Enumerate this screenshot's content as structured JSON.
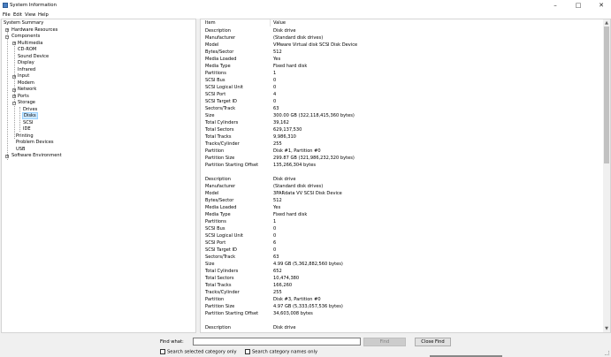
{
  "window": {
    "title": "System Information",
    "controls": [
      "minimize-icon",
      "maximize-icon",
      "close-icon"
    ]
  },
  "menu": [
    "File",
    "Edit",
    "View",
    "Help"
  ],
  "tree": {
    "system_summary": "System Summary",
    "hardware_resources": "Hardware Resources",
    "components": "Components",
    "multimedia": "Multimedia",
    "cd_rom": "CD-ROM",
    "sound_device": "Sound Device",
    "display": "Display",
    "infrared": "Infrared",
    "input": "Input",
    "modem": "Modem",
    "network": "Network",
    "ports": "Ports",
    "storage": "Storage",
    "drives": "Drives",
    "disks": "Disks",
    "scsi": "SCSI",
    "ide": "IDE",
    "printing": "Printing",
    "problem_devices": "Problem Devices",
    "usb": "USB",
    "software_environment": "Software Environment"
  },
  "details": {
    "col_item": "Item",
    "col_value": "Value",
    "disks": [
      [
        [
          "Description",
          "Disk drive"
        ],
        [
          "Manufacturer",
          "(Standard disk drives)"
        ],
        [
          "Model",
          "VMware Virtual disk SCSI Disk Device"
        ],
        [
          "Bytes/Sector",
          "512"
        ],
        [
          "Media Loaded",
          "Yes"
        ],
        [
          "Media Type",
          "Fixed hard disk"
        ],
        [
          "Partitions",
          "1"
        ],
        [
          "SCSI Bus",
          "0"
        ],
        [
          "SCSI Logical Unit",
          "0"
        ],
        [
          "SCSI Port",
          "4"
        ],
        [
          "SCSI Target ID",
          "0"
        ],
        [
          "Sectors/Track",
          "63"
        ],
        [
          "Size",
          "300.00 GB (322,118,415,360 bytes)"
        ],
        [
          "Total Cylinders",
          "39,162"
        ],
        [
          "Total Sectors",
          "629,137,530"
        ],
        [
          "Total Tracks",
          "9,986,310"
        ],
        [
          "Tracks/Cylinder",
          "255"
        ],
        [
          "Partition",
          "Disk #1, Partition #0"
        ],
        [
          "Partition Size",
          "299.87 GB (321,986,232,320 bytes)"
        ],
        [
          "Partition Starting Offset",
          "135,266,304 bytes"
        ]
      ],
      [
        [
          "Description",
          "Disk drive"
        ],
        [
          "Manufacturer",
          "(Standard disk drives)"
        ],
        [
          "Model",
          "3PARdata VV SCSI Disk Device"
        ],
        [
          "Bytes/Sector",
          "512"
        ],
        [
          "Media Loaded",
          "Yes"
        ],
        [
          "Media Type",
          "Fixed hard disk"
        ],
        [
          "Partitions",
          "1"
        ],
        [
          "SCSI Bus",
          "0"
        ],
        [
          "SCSI Logical Unit",
          "0"
        ],
        [
          "SCSI Port",
          "6"
        ],
        [
          "SCSI Target ID",
          "0"
        ],
        [
          "Sectors/Track",
          "63"
        ],
        [
          "Size",
          "4.99 GB (5,362,882,560 bytes)"
        ],
        [
          "Total Cylinders",
          "652"
        ],
        [
          "Total Sectors",
          "10,474,380"
        ],
        [
          "Total Tracks",
          "166,260"
        ],
        [
          "Tracks/Cylinder",
          "255"
        ],
        [
          "Partition",
          "Disk #3, Partition #0"
        ],
        [
          "Partition Size",
          "4.97 GB (5,333,057,536 bytes)"
        ],
        [
          "Partition Starting Offset",
          "34,603,008 bytes"
        ]
      ],
      [
        [
          "Description",
          "Disk drive"
        ]
      ]
    ]
  },
  "find": {
    "label": "Find what:",
    "value": "",
    "find_button": "Find",
    "close_button": "Close Find",
    "opt_selected": "Search selected category only",
    "opt_names": "Search category names only"
  }
}
